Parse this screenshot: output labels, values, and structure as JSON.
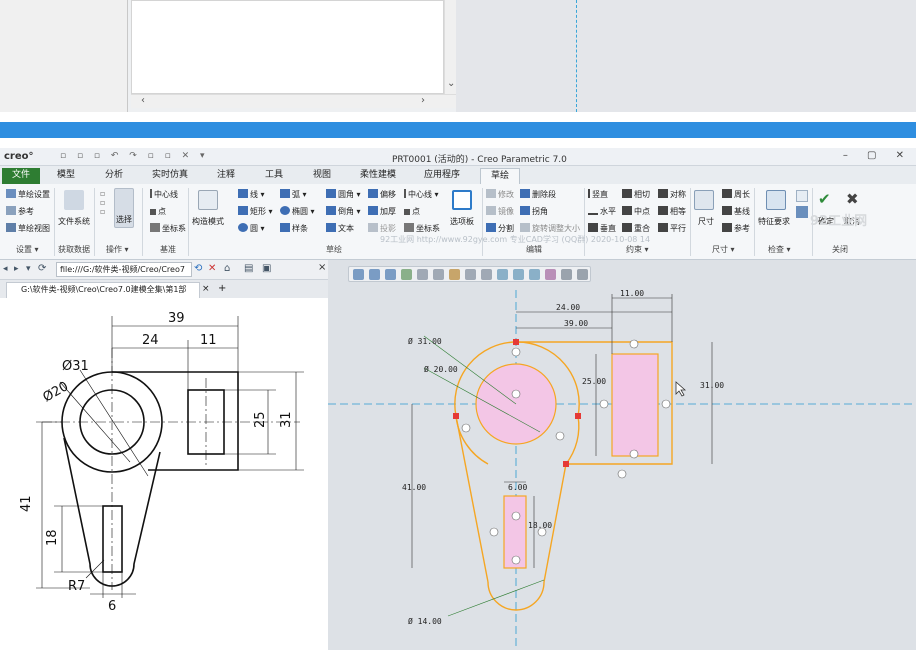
{
  "window": {
    "logo": "creo°",
    "title": "PRT0001 (活动的) - Creo Parametric 7.0",
    "controls": "– ▢ ✕"
  },
  "tabs": [
    "文件",
    "模型",
    "分析",
    "实时仿真",
    "注释",
    "工具",
    "视图",
    "柔性建模",
    "应用程序",
    "草绘"
  ],
  "ribbon": {
    "setup": {
      "items": [
        "草绘设置",
        "参考",
        "草绘视图"
      ],
      "group": "设置 ▾"
    },
    "getdata": {
      "item": "文件系统",
      "group": "获取数据"
    },
    "operations": {
      "item": "选择",
      "group": "操作 ▾"
    },
    "datum": {
      "items": [
        "中心线",
        "点",
        "坐标系"
      ],
      "group": "基准"
    },
    "sketch": {
      "construction": "构造模式",
      "col1": [
        "线 ▾",
        "矩形 ▾",
        "圆 ▾"
      ],
      "col2": [
        "弧 ▾",
        "椭圆 ▾",
        "样条"
      ],
      "col3": [
        "圆角 ▾",
        "倒角 ▾",
        "文本"
      ],
      "col4": [
        "偏移",
        "加厚",
        "投影"
      ],
      "col5": [
        "中心线 ▾",
        "点",
        "坐标系"
      ],
      "palette": "选项板",
      "group": "草绘"
    },
    "edit": {
      "items": [
        "修改",
        "删除段",
        "镜像",
        "拐角",
        "分割",
        "旋转调整大小"
      ],
      "group": "编辑"
    },
    "constrain": {
      "col1": [
        "竖直",
        "水平",
        "垂直"
      ],
      "col2": [
        "相切",
        "中点",
        "重合"
      ],
      "col3": [
        "对称",
        "相等",
        "平行"
      ],
      "group": "约束 ▾"
    },
    "dimension": {
      "item": "尺寸",
      "items": [
        "周长",
        "基线",
        "参考"
      ],
      "group": "尺寸 ▾"
    },
    "inspect": {
      "item": "特征要求",
      "group": "检查 ▾"
    },
    "close": {
      "items": [
        "确定",
        "取消"
      ],
      "group": "关闭"
    }
  },
  "watermark": "92工业网 http://www.92gye.com 专业CAD学习 (QQ群) 2020-10-08 14",
  "brand": "92工业网",
  "browser": {
    "address": "file:///G:/软件类-视频/Creo/Creo7",
    "tab": "G:\\软件类-视频\\Creo\\Creo7.0建模全集\\第1部"
  },
  "drawing_dims": {
    "d39": "39",
    "d24": "24",
    "d11": "11",
    "d25": "25",
    "d31": "31",
    "d41": "41",
    "d18": "18",
    "d6": "6",
    "phi31": "Ø31",
    "phi20": "Ø20",
    "r7": "R7"
  },
  "sketch_dims": {
    "d11": "11.00",
    "d24": "24.00",
    "d39": "39.00",
    "phi31": "Ø 31.00",
    "phi20": "Ø 20.00",
    "d25": "25.00",
    "d31": "31.00",
    "d41": "41.00",
    "d6": "6.00",
    "d18": "18.00",
    "phi14": "Ø 14.00"
  },
  "colors": {
    "accent": "#2e8ee0",
    "file_tab": "#2e7d32",
    "sketch": "#f5a623",
    "fill": "#f3c6e6",
    "green": "#2e7d32"
  }
}
